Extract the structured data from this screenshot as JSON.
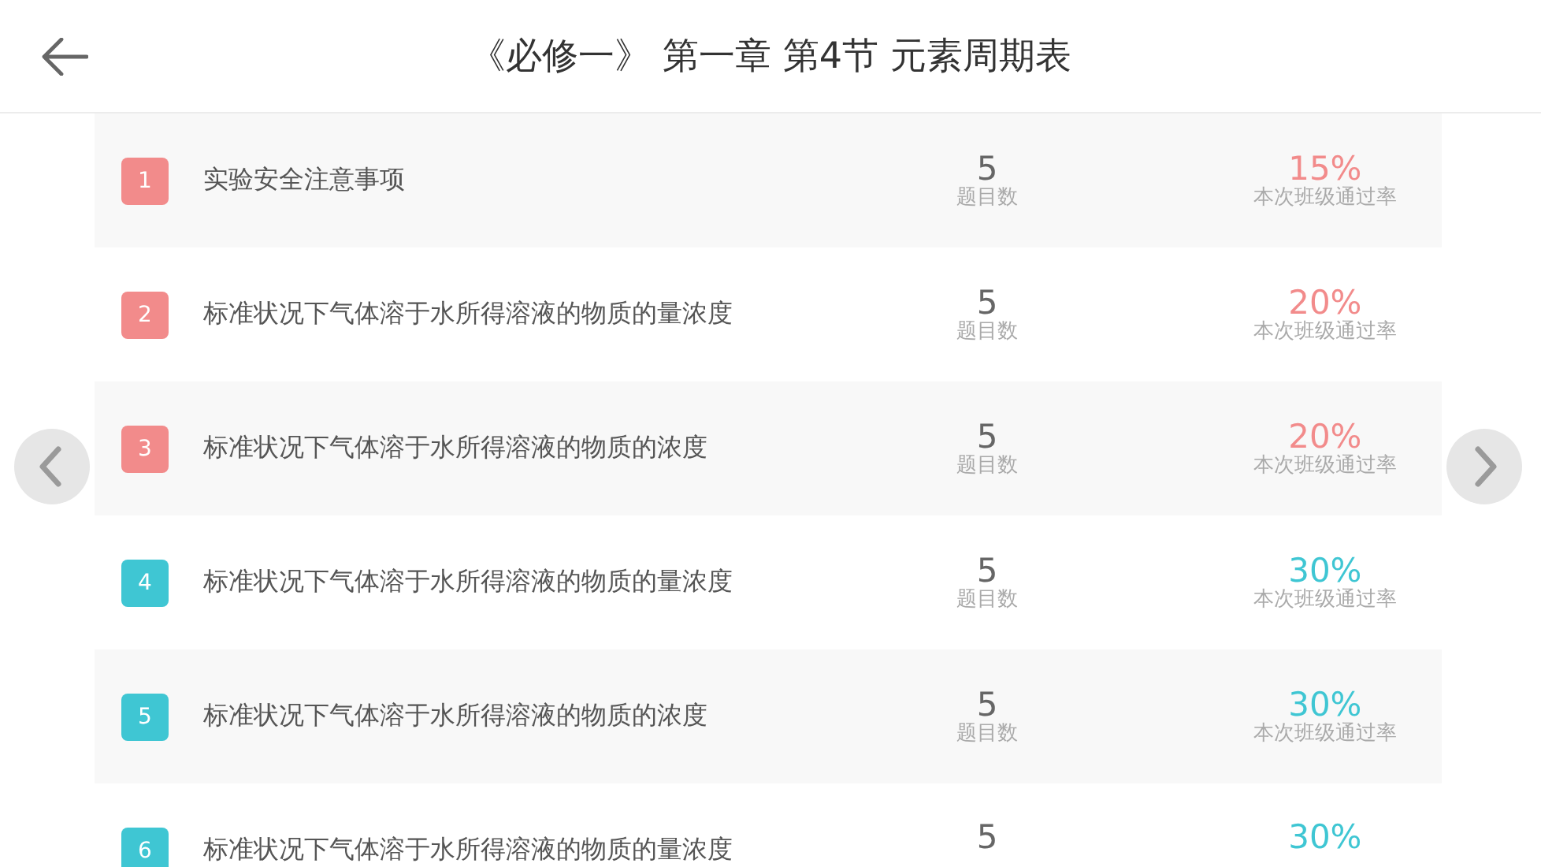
{
  "header": {
    "title": "《必修一》 第一章  第4节  元素周期表"
  },
  "items": [
    {
      "number": "1",
      "title": "实验安全注意事项",
      "count": "5",
      "count_label": "题目数",
      "rate": "15%",
      "rate_label": "本次班级通过率",
      "color": "#f28b8b"
    },
    {
      "number": "2",
      "title": "标准状况下气体溶于水所得溶液的物质的量浓度",
      "count": "5",
      "count_label": "题目数",
      "rate": "20%",
      "rate_label": "本次班级通过率",
      "color": "#f28b8b"
    },
    {
      "number": "3",
      "title": "标准状况下气体溶于水所得溶液的物质的浓度",
      "count": "5",
      "count_label": "题目数",
      "rate": "20%",
      "rate_label": "本次班级通过率",
      "color": "#f28b8b"
    },
    {
      "number": "4",
      "title": "标准状况下气体溶于水所得溶液的物质的量浓度",
      "count": "5",
      "count_label": "题目数",
      "rate": "30%",
      "rate_label": "本次班级通过率",
      "color": "#3fc6d3"
    },
    {
      "number": "5",
      "title": "标准状况下气体溶于水所得溶液的物质的浓度",
      "count": "5",
      "count_label": "题目数",
      "rate": "30%",
      "rate_label": "本次班级通过率",
      "color": "#3fc6d3"
    },
    {
      "number": "6",
      "title": "标准状况下气体溶于水所得溶液的物质的量浓度",
      "count": "5",
      "rate": "30%",
      "color": "#3fc6d3"
    }
  ]
}
